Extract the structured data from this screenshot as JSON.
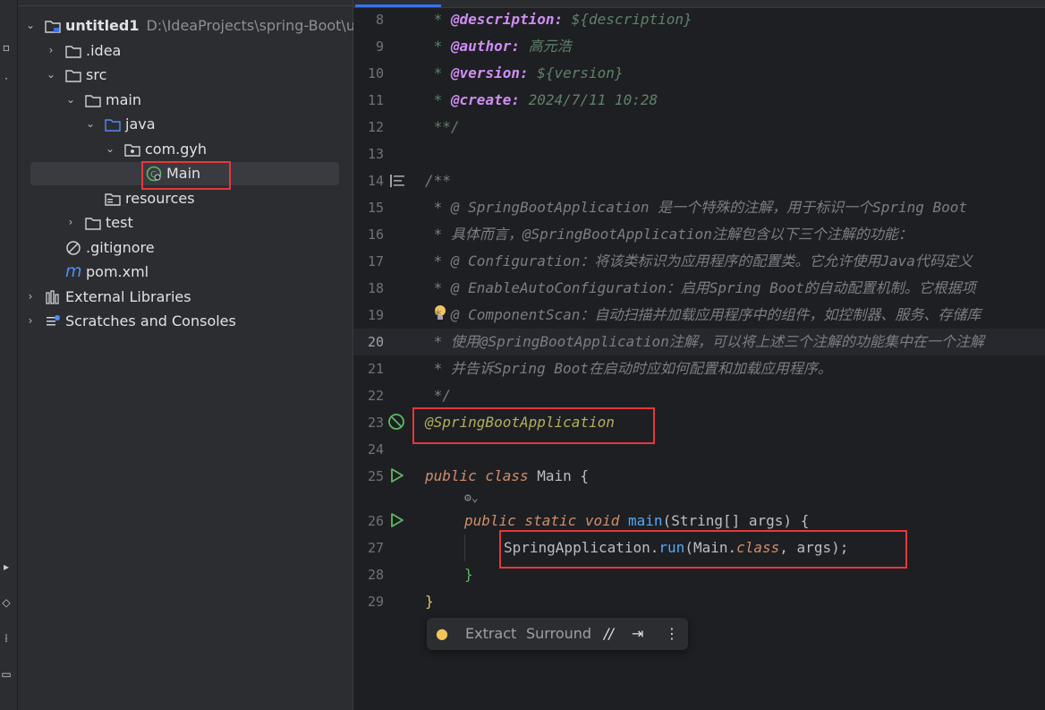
{
  "project_tree": {
    "rows": [
      {
        "label": "untitled1",
        "path": "D:\\IdeaProjects\\spring-Boot\\un"
      },
      {
        "label": ".idea"
      },
      {
        "label": "src"
      },
      {
        "label": "main"
      },
      {
        "label": "java"
      },
      {
        "label": "com.gyh"
      },
      {
        "label": "Main"
      },
      {
        "label": "resources"
      },
      {
        "label": "test"
      },
      {
        "label": ".gitignore"
      },
      {
        "label": "pom.xml"
      },
      {
        "label": "External Libraries"
      },
      {
        "label": "Scratches and Consoles"
      }
    ]
  },
  "editor": {
    "current_line": 20,
    "lines": [
      {
        "n": "8"
      },
      {
        "n": "9"
      },
      {
        "n": "10"
      },
      {
        "n": "11"
      },
      {
        "n": "12"
      },
      {
        "n": "13"
      },
      {
        "n": "14"
      },
      {
        "n": "15"
      },
      {
        "n": "16"
      },
      {
        "n": "17"
      },
      {
        "n": "18"
      },
      {
        "n": "19"
      },
      {
        "n": "20"
      },
      {
        "n": "21"
      },
      {
        "n": "22"
      },
      {
        "n": "23"
      },
      {
        "n": "24"
      },
      {
        "n": "25"
      },
      {
        "n": ""
      },
      {
        "n": "26"
      },
      {
        "n": "27"
      },
      {
        "n": "28"
      },
      {
        "n": "29"
      }
    ],
    "code": {
      "l8_tag": "@description:",
      "l8_val": " ${description}",
      "l9_tag": "@author:",
      "l9_val": " 高元浩",
      "l10_tag": "@version:",
      "l10_val": " ${version}",
      "l11_tag": "@create:",
      "l11_val": " 2024/7/11 10:28",
      "l12": " **/",
      "l14": "/**",
      "l15": " * @ SpringBootApplication 是一个特殊的注解，用于标识一个Spring Boot",
      "l16": " * 具体而言，@SpringBootApplication注解包含以下三个注解的功能：",
      "l17": " * @ Configuration：将该类标识为应用程序的配置类。它允许使用Java代码定义",
      "l18": " * @ EnableAutoConfiguration：启用Spring Boot的自动配置机制。它根据项",
      "l19": " * @ ComponentScan：自动扫描并加载应用程序中的组件，如控制器、服务、存储库",
      "l20": " * 使用@SpringBootApplication注解，可以将上述三个注解的功能集中在一个注解",
      "l21": " * 并告诉Spring Boot在启动时应如何配置和加载应用程序。",
      "l22": " */",
      "l23": "@SpringBootApplication",
      "l25_kw": "public class",
      "l25_name": " Main",
      "l25_brace": " {",
      "l26_kw": "public static void",
      "l26_fn": " main",
      "l26_rest": "(String[] args) {",
      "l27_cls": "SpringApplication",
      "l27_dot": ".",
      "l27_fn": "run",
      "l27_open": "(Main.",
      "l27_kw": "class",
      "l27_rest": ", args);",
      "l28": "}",
      "l29": "}"
    }
  },
  "float_toolbar": {
    "extract": "Extract",
    "surround": "Surround"
  }
}
